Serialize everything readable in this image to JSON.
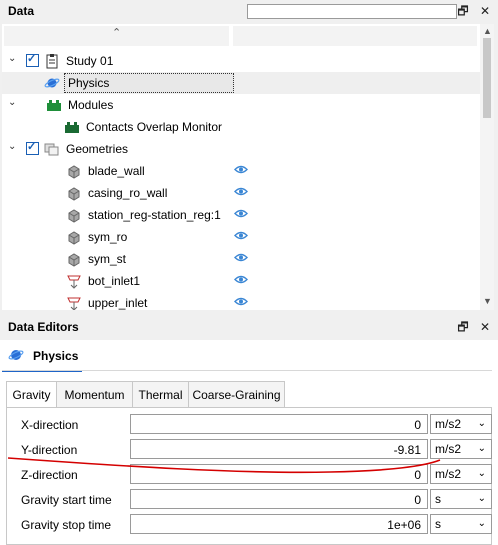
{
  "data_panel": {
    "title": "Data",
    "search_value": "",
    "restore_icon": "restore-window-icon",
    "close_icon": "close-icon"
  },
  "tree": [
    {
      "label": "Study 01",
      "icon": "clipboard-icon",
      "checked": true,
      "expanded": true
    },
    {
      "label": "Physics",
      "icon": "physics-planet-icon",
      "selected": true
    },
    {
      "label": "Modules",
      "icon": "modules-green-icon",
      "expanded": true
    },
    {
      "label": "Contacts Overlap Monitor",
      "icon": "module-block-icon"
    },
    {
      "label": "Geometries",
      "icon": "geometries-icon",
      "checked": true,
      "expanded": true
    },
    {
      "label": "blade_wall",
      "icon": "geometry-mesh-icon",
      "visible": true
    },
    {
      "label": "casing_ro_wall",
      "icon": "geometry-mesh-icon",
      "visible": true
    },
    {
      "label": "station_reg-station_reg:1",
      "icon": "geometry-mesh-icon",
      "visible": true
    },
    {
      "label": "sym_ro",
      "icon": "geometry-mesh-icon",
      "visible": true
    },
    {
      "label": "sym_st",
      "icon": "geometry-mesh-icon",
      "visible": true
    },
    {
      "label": "bot_inlet1",
      "icon": "inlet-icon",
      "visible": true
    },
    {
      "label": "upper_inlet",
      "icon": "inlet-icon",
      "visible": true
    }
  ],
  "editor_panel": {
    "title": "Data Editors",
    "tab": "Physics",
    "subtabs": [
      "Gravity",
      "Momentum",
      "Thermal",
      "Coarse-Graining"
    ],
    "active_subtab": "Gravity",
    "fields": [
      {
        "label": "X-direction",
        "value": "0",
        "unit": "m/s2"
      },
      {
        "label": "Y-direction",
        "value": "-9.81",
        "unit": "m/s2"
      },
      {
        "label": "Z-direction",
        "value": "0",
        "unit": "m/s2"
      },
      {
        "label": "Gravity start time",
        "value": "0",
        "unit": "s"
      },
      {
        "label": "Gravity stop time",
        "value": "1e+06",
        "unit": "s"
      }
    ]
  },
  "colors": {
    "accent": "#1e64c8",
    "eye": "#3a86d4",
    "annotation": "#d40000"
  }
}
